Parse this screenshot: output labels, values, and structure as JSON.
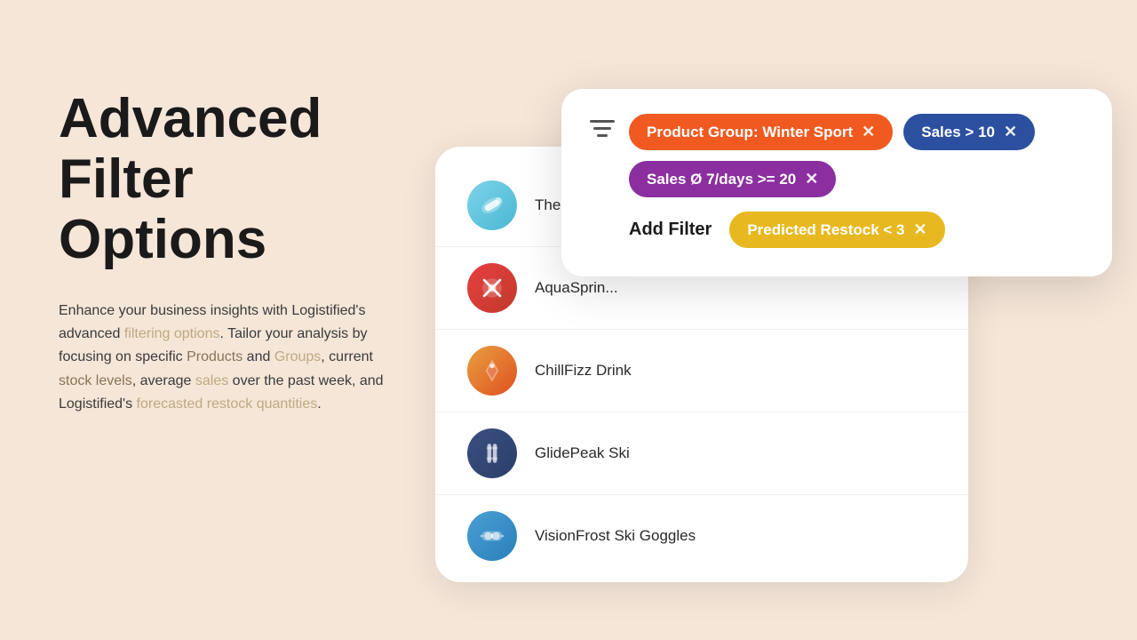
{
  "page": {
    "background_color": "#f5e6d8"
  },
  "left": {
    "heading_line1": "Advanced",
    "heading_line2": "Filter",
    "heading_line3": "Options",
    "description_parts": [
      {
        "text": "Enhance your business insights with Logistified's advanced ",
        "type": "normal"
      },
      {
        "text": "filtering options",
        "type": "link"
      },
      {
        "text": ". Tailor your analysis by focusing on specific ",
        "type": "normal"
      },
      {
        "text": "Products",
        "type": "link-dark"
      },
      {
        "text": " and ",
        "type": "normal"
      },
      {
        "text": "Groups",
        "type": "link"
      },
      {
        "text": ", current ",
        "type": "normal"
      },
      {
        "text": "stock levels",
        "type": "link-dark"
      },
      {
        "text": ", average ",
        "type": "normal"
      },
      {
        "text": "sales",
        "type": "link"
      },
      {
        "text": " over the past week, and Logistified's ",
        "type": "normal"
      },
      {
        "text": "forecasted restock quantities",
        "type": "link"
      },
      {
        "text": ".",
        "type": "normal"
      }
    ]
  },
  "filter_card": {
    "filter_icon_label": "filter-lines-icon",
    "tags": [
      {
        "id": "tag-product-group",
        "label": "Product Group: Winter Sport",
        "color": "orange"
      },
      {
        "id": "tag-sales-gt10",
        "label": "Sales > 10",
        "color": "blue"
      },
      {
        "id": "tag-sales-avg",
        "label": "Sales Ø 7/days >= 20",
        "color": "purple"
      },
      {
        "id": "tag-restock",
        "label": "Predicted Restock < 3",
        "color": "yellow"
      }
    ],
    "add_filter_label": "Add Filter",
    "close_symbol": "×"
  },
  "product_list": {
    "items": [
      {
        "id": "item-1",
        "name": "The Min...",
        "icon_type": "mint"
      },
      {
        "id": "item-2",
        "name": "AquaSprin...",
        "icon_type": "aqua"
      },
      {
        "id": "item-3",
        "name": "ChillFizz Drink",
        "icon_type": "chill"
      },
      {
        "id": "item-4",
        "name": "GlidePeak Ski",
        "icon_type": "glide"
      },
      {
        "id": "item-5",
        "name": "VisionFrost Ski Goggles",
        "icon_type": "vision"
      }
    ]
  }
}
